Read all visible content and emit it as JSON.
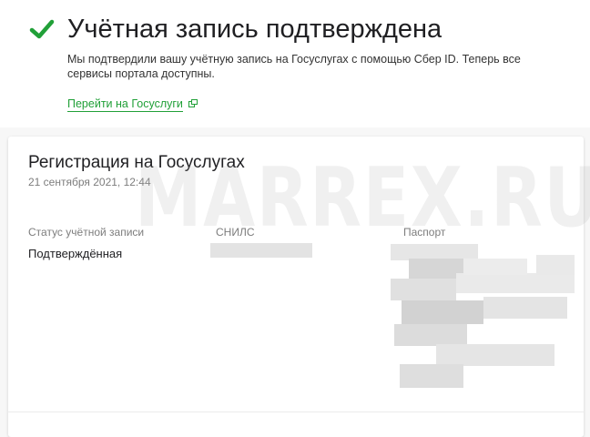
{
  "header": {
    "title": "Учётная запись подтверждена",
    "message": "Мы подтвердили вашу учётную запись на Госуслугах с помощью Сбер ID. Теперь все сервисы портала доступны.",
    "link_label": "Перейти на Госуслуги",
    "check_icon": "checkmark-icon",
    "link_icon": "external-link-icon"
  },
  "card": {
    "title": "Регистрация на Госуслугах",
    "date": "21 сентября 2021, 12:44",
    "fields": [
      {
        "label": "Статус учётной записи",
        "value": "Подтверждённая"
      },
      {
        "label": "СНИЛС",
        "value": ""
      },
      {
        "label": "Паспорт",
        "value": ""
      }
    ]
  },
  "watermark": "MARREX.RU",
  "colors": {
    "accent": "#21a038",
    "text": "#1f1f22",
    "muted": "#7d7d7d",
    "background": "#f7f7f7",
    "card": "#ffffff"
  }
}
